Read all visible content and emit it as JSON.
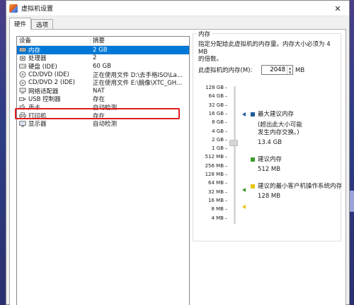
{
  "window": {
    "title": "虚拟机设置",
    "close_glyph": "✕"
  },
  "tabs": [
    {
      "label": "硬件"
    },
    {
      "label": "选项"
    }
  ],
  "device_list": {
    "headers": {
      "device": "设备",
      "summary": "摘要"
    },
    "rows": [
      {
        "name": "内存",
        "summary": "2 GB",
        "icon": "memory-icon",
        "selected": true
      },
      {
        "name": "处理器",
        "summary": "2",
        "icon": "cpu-icon"
      },
      {
        "name": "硬盘 (IDE)",
        "summary": "60 GB",
        "icon": "hard-disk-icon"
      },
      {
        "name": "CD/DVD (IDE)",
        "summary": "正在使用文件 D:\\去手格ISO\\La...",
        "icon": "cd-dvd-icon"
      },
      {
        "name": "CD/DVD 2 (IDE)",
        "summary": "正在使用文件 E:\\鏡像\\XTC_GH...",
        "icon": "cd-dvd-icon"
      },
      {
        "name": "网络适配器",
        "summary": "NAT",
        "icon": "network-adapter-icon"
      },
      {
        "name": "USB 控制器",
        "summary": "存在",
        "icon": "usb-icon"
      },
      {
        "name": "声卡",
        "summary": "自动检测",
        "icon": "sound-card-icon"
      },
      {
        "name": "打印机",
        "summary": "存在",
        "icon": "printer-icon"
      },
      {
        "name": "显示器",
        "summary": "自动检测",
        "icon": "display-icon"
      }
    ]
  },
  "memory": {
    "group_title": "内存",
    "description_line1": "指定分配给此虚拟机的内存量。内存大小必须为 4 MB",
    "description_line2": "的倍数。",
    "field_label": "此虚拟机的内存(M):",
    "value": "2048",
    "unit": "MB",
    "scale_labels": [
      "128 GB",
      "64 GB",
      "32 GB",
      "16 GB",
      "8 GB",
      "4 GB",
      "2 GB",
      "1 GB",
      "512 MB",
      "256 MB",
      "128 MB",
      "64 MB",
      "32 MB",
      "16 MB",
      "8 MB",
      "4 MB"
    ],
    "max_recommended": {
      "title": "最大建议内存",
      "note_line1": "(超出此大小可能",
      "note_line2": "发生内存交换。)",
      "value": "13.4 GB",
      "color": "#1f5c99"
    },
    "recommended": {
      "title": "建议内存",
      "value": "512 MB",
      "color": "#3c9a2c"
    },
    "guest_min": {
      "title": "建议的最小客户机操作系统内存",
      "value": "128 MB",
      "color": "#e8c410"
    }
  }
}
